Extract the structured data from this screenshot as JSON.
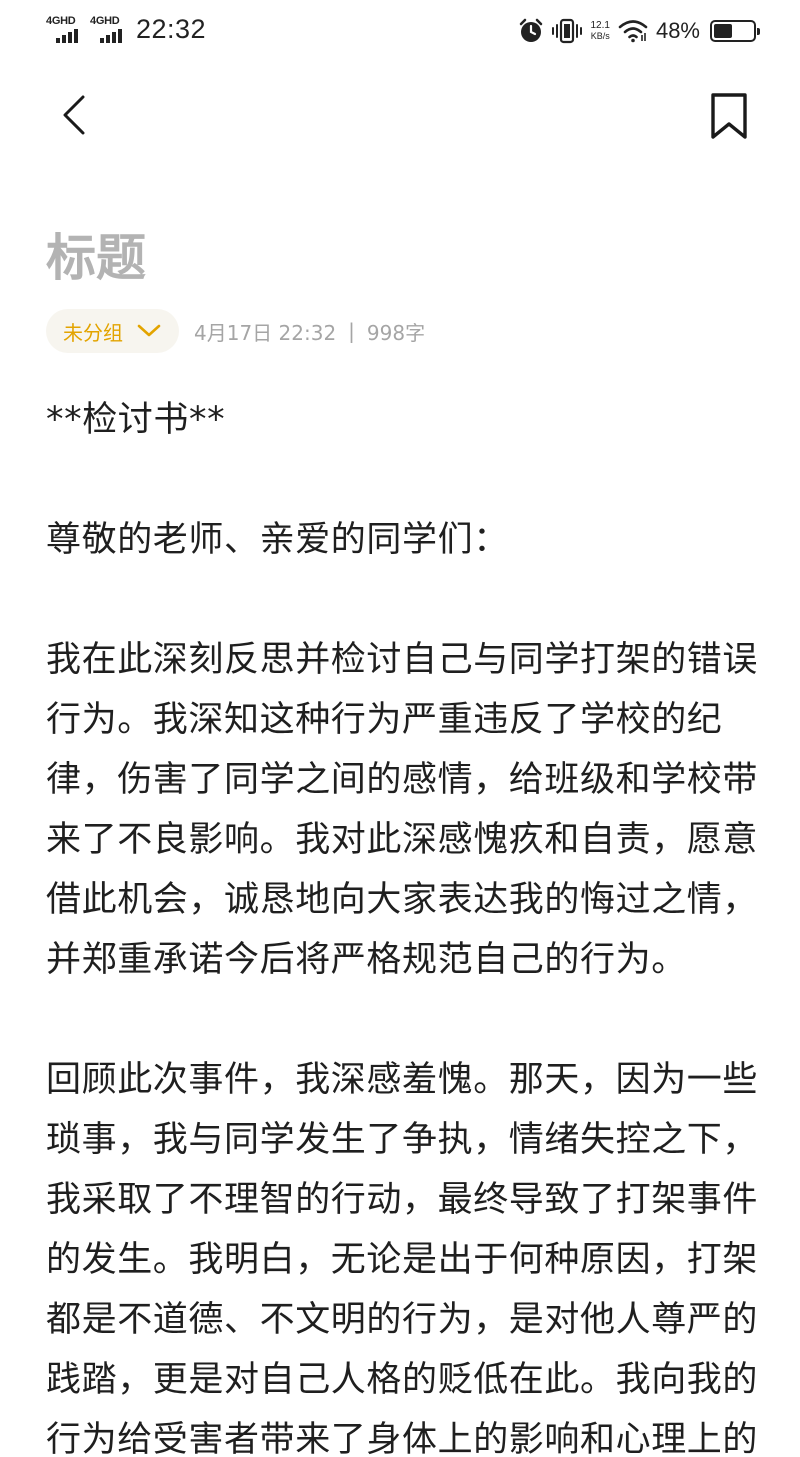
{
  "status_bar": {
    "signal1_label": "4GHD",
    "signal2_label": "4GHD",
    "time": "22:32",
    "net_speed_value": "12.1",
    "net_speed_unit": "KB/s",
    "battery_text": "48%",
    "battery_level": 0.48,
    "icons": [
      "alarm-icon",
      "vibrate-icon",
      "wifi-icon",
      "battery-icon"
    ]
  },
  "nav": {
    "back_icon": "chevron-left-icon",
    "bookmark_icon": "bookmark-icon"
  },
  "note": {
    "title": "标题",
    "group_label": "未分组",
    "date": "4月17日 22:32",
    "separator": "|",
    "word_count": "998字",
    "paragraphs": [
      "**检讨书**",
      "尊敬的老师、亲爱的同学们：",
      "我在此深刻反思并检讨自己与同学打架的错误行为。我深知这种行为严重违反了学校的纪律，伤害了同学之间的感情，给班级和学校带来了不良影响。我对此深感愧疚和自责，愿意借此机会，诚恳地向大家表达我的悔过之情，并郑重承诺今后将严格规范自己的行为。",
      "回顾此次事件，我深感羞愧。那天，因为一些琐事，我与同学发生了争执，情绪失控之下，我采取了不理智的行动，最终导致了打架事件的发生。我明白，无论是出于何种原因，打架都是不道德、不文明的行为，是对他人尊严的践踏，更是对自己人格的贬低在此。我向我的行为给受害者带来了身体上的影响和心理上的"
    ]
  },
  "colors": {
    "accent": "#e3a400",
    "title_placeholder": "#b3b3b3",
    "meta_text": "#a5a5a5",
    "chip_bg": "#f7f5ef",
    "body_text": "#1f1f1f"
  }
}
